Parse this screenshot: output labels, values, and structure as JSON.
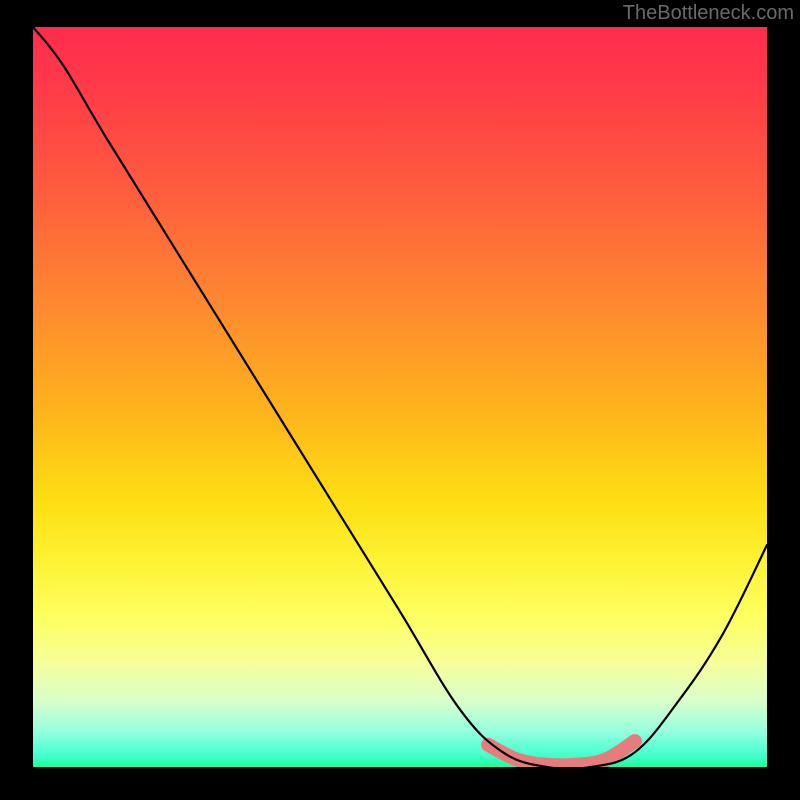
{
  "watermark": "TheBottleneck.com",
  "chart_data": {
    "type": "line",
    "title": "",
    "xlabel": "",
    "ylabel": "",
    "xlim": [
      0,
      1
    ],
    "ylim": [
      0,
      1
    ],
    "series": [
      {
        "name": "main-curve",
        "x": [
          0.0,
          0.04,
          0.1,
          0.2,
          0.3,
          0.4,
          0.5,
          0.58,
          0.64,
          0.7,
          0.76,
          0.82,
          0.88,
          0.94,
          1.0
        ],
        "y": [
          1.0,
          0.95,
          0.85,
          0.69,
          0.53,
          0.37,
          0.21,
          0.08,
          0.02,
          0.0,
          0.0,
          0.02,
          0.09,
          0.18,
          0.3
        ]
      },
      {
        "name": "optimal-band",
        "x": [
          0.62,
          0.66,
          0.7,
          0.74,
          0.78,
          0.82
        ],
        "y": [
          0.03,
          0.01,
          0.003,
          0.003,
          0.01,
          0.035
        ]
      }
    ],
    "colors": {
      "gradient_top": "#ff2c4c",
      "gradient_bottom": "#1affa0",
      "band": "#e77c7c",
      "line": "#000000",
      "background": "#000000"
    }
  }
}
